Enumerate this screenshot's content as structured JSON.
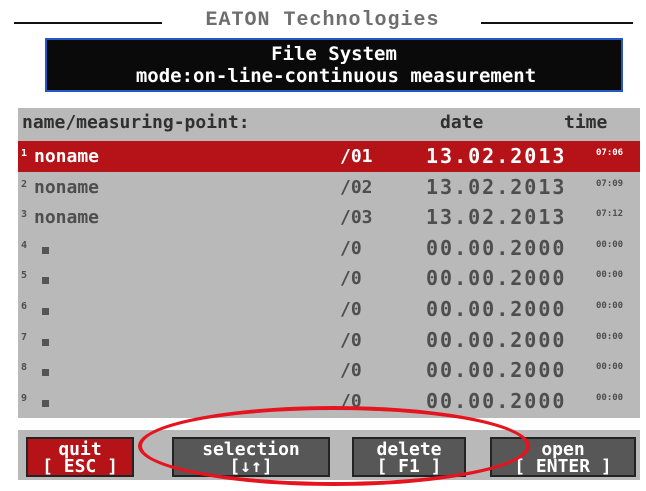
{
  "window": {
    "title": "EATON Technologies"
  },
  "header": {
    "title": "File System",
    "mode": "mode:on-line-continuous measurement"
  },
  "table": {
    "columns": {
      "name": "name/measuring-point:",
      "date": "date",
      "time": "time"
    },
    "rows": [
      {
        "num": "1",
        "name": "noname",
        "point": "/01",
        "date": "13.02.2013",
        "time": "07:06",
        "selected": true
      },
      {
        "num": "2",
        "name": "noname",
        "point": "/02",
        "date": "13.02.2013",
        "time": "07:09",
        "selected": false
      },
      {
        "num": "3",
        "name": "noname",
        "point": "/03",
        "date": "13.02.2013",
        "time": "07:12",
        "selected": false
      },
      {
        "num": "4",
        "name": "",
        "point": "/0",
        "date": "00.00.2000",
        "time": "00:00",
        "selected": false
      },
      {
        "num": "5",
        "name": "",
        "point": "/0",
        "date": "00.00.2000",
        "time": "00:00",
        "selected": false
      },
      {
        "num": "6",
        "name": "",
        "point": "/0",
        "date": "00.00.2000",
        "time": "00:00",
        "selected": false
      },
      {
        "num": "7",
        "name": "",
        "point": "/0",
        "date": "00.00.2000",
        "time": "00:00",
        "selected": false
      },
      {
        "num": "8",
        "name": "",
        "point": "/0",
        "date": "00.00.2000",
        "time": "00:00",
        "selected": false
      },
      {
        "num": "9",
        "name": "",
        "point": "/0",
        "date": "00.00.2000",
        "time": "00:00",
        "selected": false
      }
    ]
  },
  "buttons": {
    "quit": {
      "label": "quit",
      "key": "[ ESC ]"
    },
    "selection": {
      "label": "selection",
      "key": "[↓↑]"
    },
    "delete": {
      "label": "delete",
      "key": "[ F1 ]"
    },
    "open": {
      "label": "open",
      "key": "[ ENTER ]"
    }
  },
  "colors": {
    "selected_row": "#b51317",
    "panel": "#b9b9b9",
    "header_bg": "#0a0a0a",
    "header_border": "#2458c7",
    "annotation_ellipse": "#e5141e"
  }
}
